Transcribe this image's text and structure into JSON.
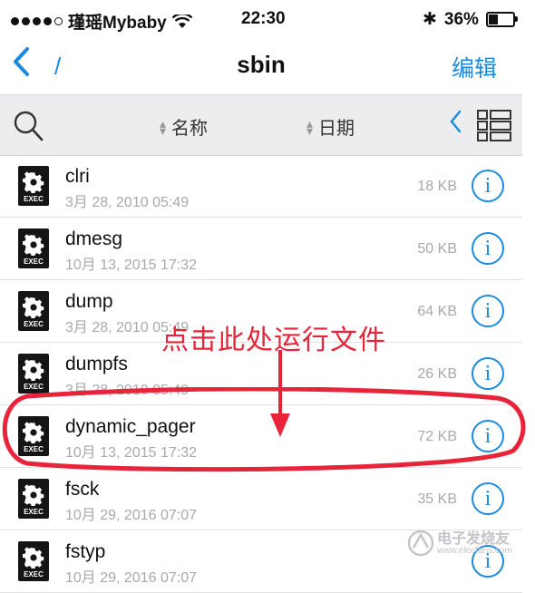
{
  "status_bar": {
    "carrier": "瑾瑶Mybaby",
    "time": "22:30",
    "battery": "36%"
  },
  "nav": {
    "back_path": "/",
    "title": "sbin",
    "edit_label": "编辑"
  },
  "toolbar": {
    "sort_name": "名称",
    "sort_date": "日期"
  },
  "files": [
    {
      "name": "clri",
      "date": "3月 28, 2010 05:49",
      "size": "18 KB",
      "icon_label": "EXEC"
    },
    {
      "name": "dmesg",
      "date": "10月 13, 2015 17:32",
      "size": "50 KB",
      "icon_label": "EXEC"
    },
    {
      "name": "dump",
      "date": "3月 28, 2010 05:49",
      "size": "64 KB",
      "icon_label": "EXEC"
    },
    {
      "name": "dumpfs",
      "date": "3月 28, 2010 05:49",
      "size": "26 KB",
      "icon_label": "EXEC"
    },
    {
      "name": "dynamic_pager",
      "date": "10月 13, 2015 17:32",
      "size": "72 KB",
      "icon_label": "EXEC"
    },
    {
      "name": "fsck",
      "date": "10月 29, 2016 07:07",
      "size": "35 KB",
      "icon_label": "EXEC"
    },
    {
      "name": "fstyp",
      "date": "10月 29, 2016 07:07",
      "size": "",
      "icon_label": "EXEC"
    }
  ],
  "annotation": {
    "text": "点击此处运行文件",
    "color": "#e8243a"
  },
  "watermark": {
    "line1": "电子发烧友",
    "line2": "www.elecfans.com"
  },
  "colors": {
    "accent": "#1a8be0",
    "annotation": "#e8243a"
  }
}
